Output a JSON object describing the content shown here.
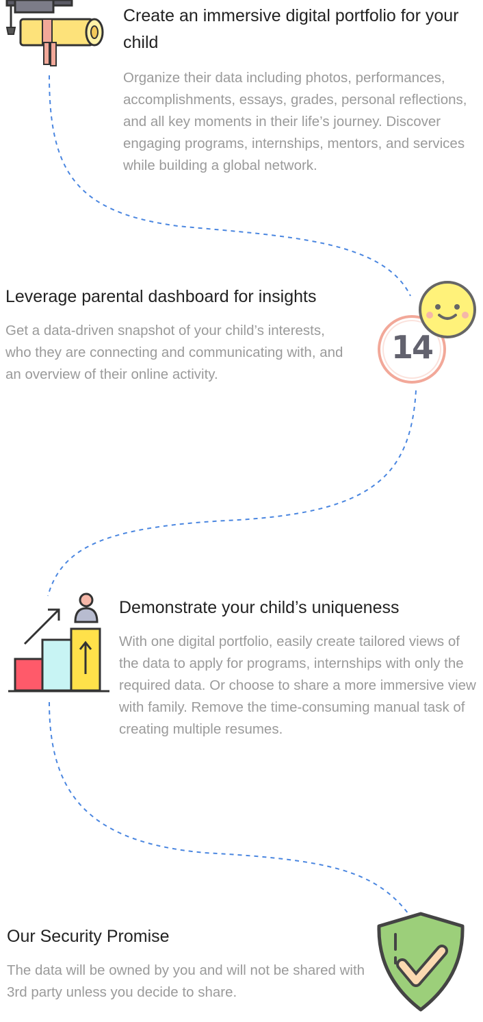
{
  "features": [
    {
      "title": "Create an immersive digital portfolio for your child",
      "desc": "Organize their data including photos, performances, accomplishments, essays, grades, personal reflections, and all key moments in their life’s journey. Discover engaging programs, internships, mentors, and services while building a global network.",
      "icon": "graduation-diploma-icon"
    },
    {
      "title": "Leverage parental dashboard for insights",
      "desc": "Get a data-driven snapshot of your child’s interests, who they are connecting and communicating with, and an overview of their online activity.",
      "icon": "smiley-age-badge-icon",
      "badge_number": "14"
    },
    {
      "title": "Demonstrate your child’s uniqueness",
      "desc": "With one digital portfolio, easily create tailored views of the data to apply for programs, internships with only the required data. Or choose to share a more immersive view with family. Remove the time-consuming manual task of creating multiple resumes.",
      "icon": "growth-chart-person-icon"
    },
    {
      "title": "Our Security Promise",
      "desc": "The data will be owned by you and will not be shared with 3rd party unless you decide to share.",
      "icon": "security-shield-check-icon"
    }
  ],
  "colors": {
    "path": "#4a86e0",
    "title": "#222222",
    "desc": "#9a9a9a",
    "shield": "#9ccf7a",
    "smiley": "#fff27a",
    "badge_ring": "#f2a899"
  }
}
